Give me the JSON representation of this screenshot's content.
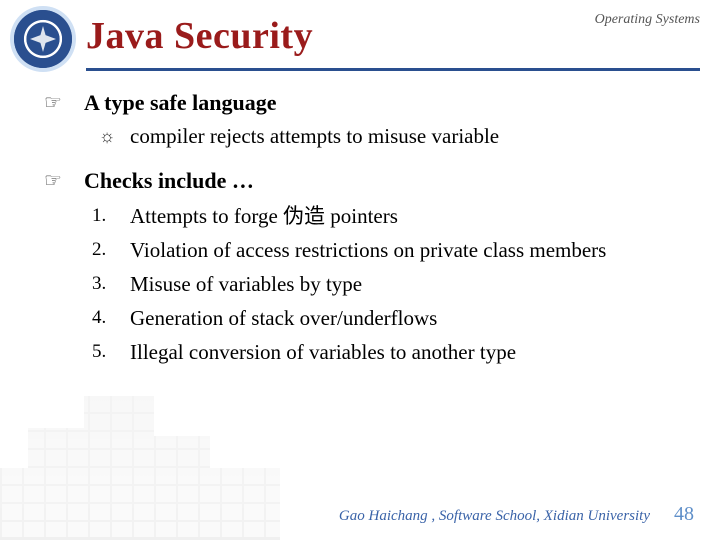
{
  "header": {
    "title": "Java Security",
    "corner": "Operating Systems"
  },
  "bullets": {
    "b1_1": "A type safe language",
    "b2_1": "compiler rejects attempts to misuse variable",
    "b1_2": "Checks include …",
    "n1": "1.",
    "n2": "2.",
    "n3": "3.",
    "n4": "4.",
    "n5": "5.",
    "c1": "Attempts to forge 伪造 pointers",
    "c2": "Violation of access restrictions on private class members",
    "c3": "Misuse of variables by type",
    "c4": "Generation of stack over/underflows",
    "c5": "Illegal conversion of variables to another type"
  },
  "footer": {
    "credit": "Gao Haichang , Software School, Xidian University",
    "page": "48"
  },
  "marks": {
    "hand": "☞",
    "sun": "☼"
  }
}
